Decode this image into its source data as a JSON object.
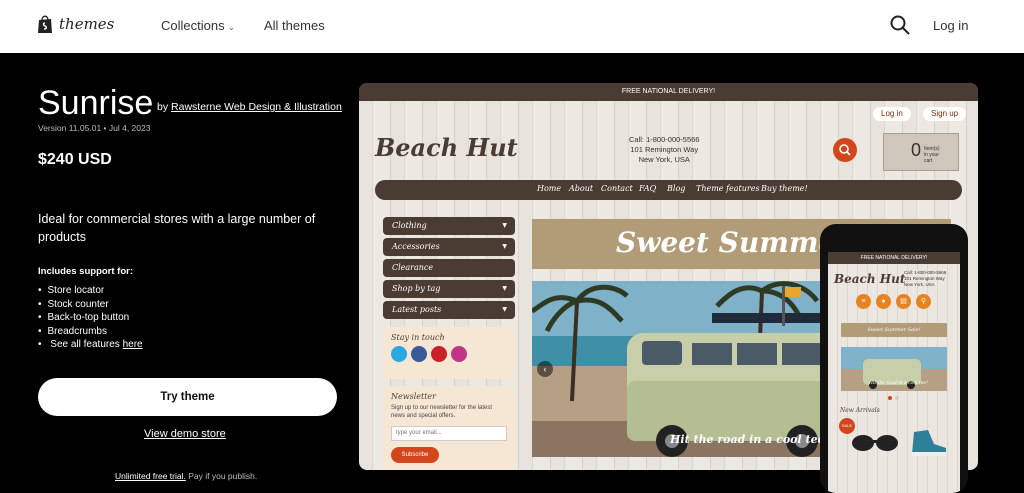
{
  "nav": {
    "brand": "themes",
    "collections": "Collections",
    "all_themes": "All themes",
    "login": "Log in",
    "icons": {
      "logo": "shopify-bag-icon",
      "search": "search-icon",
      "collections_chevron": "chevron-down-icon"
    }
  },
  "theme": {
    "name": "Sunrise",
    "by_prefix": "by",
    "author": "Rawsterne Web Design & Illustration",
    "version": "Version 11.05.01 • Jul 4, 2023",
    "price": "$240 USD",
    "description": "Ideal for commercial stores with a large number of products",
    "support_title": "Includes support for:",
    "support_items": [
      "Store locator",
      "Stock counter",
      "Back-to-top button",
      "Breadcrumbs"
    ],
    "see_all_prefix": "See all features",
    "see_all_link": "here",
    "try_button": "Try theme",
    "demo_link": "View demo store",
    "trial_link": "Unlimited free trial.",
    "trial_text": "Pay if you publish."
  },
  "preview": {
    "delivery": "FREE NATIONAL DELIVERY!",
    "login": "Log in",
    "signup": "Sign up",
    "logo": "Beach Hut",
    "contact": [
      "Call: 1-800-000-5566",
      "101 Remington Way",
      "New York, USA"
    ],
    "cart_count": "0",
    "cart_label": [
      "Item(s)",
      "in your",
      "cart"
    ],
    "nav_items": [
      "Home",
      "About",
      "Contact",
      "FAQ",
      "Blog",
      "Theme features",
      "Buy theme!"
    ],
    "sidebar": [
      "Clothing",
      "Accessories",
      "Clearance",
      "Shop by tag",
      "Latest posts"
    ],
    "stay_in_touch": "Stay in touch",
    "newsletter_title": "Newsletter",
    "newsletter_text": "Sign up to our newsletter for the latest news and special offers.",
    "newsletter_placeholder": "type your email...",
    "subscribe": "Subscribe",
    "banner": "Sweet Summer Sale!",
    "hero_caption": "Hit the road in a cool tee!",
    "colors": {
      "brown": "#4a3b33",
      "orange": "#d2461c",
      "banner": "#b19c77"
    }
  },
  "phone": {
    "delivery": "FREE NATIONAL DELIVERY!",
    "logo": "Beach Hut",
    "contact": [
      "Call: 1-800-000-5566",
      "101 Remington Way",
      "New York, USA"
    ],
    "banner": "Sweet Summer Sale!",
    "hero_caption": "Hit the road in a cool tee!",
    "new_arrivals": "New Arrivals",
    "badge": "SALE"
  }
}
